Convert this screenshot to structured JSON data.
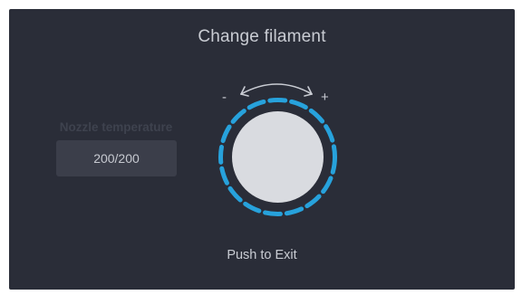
{
  "screen": {
    "title": "Change filament",
    "nozzle": {
      "label": "Nozzle temperature",
      "value": "200/200"
    },
    "knob": {
      "minus_label": "-",
      "plus_label": "+",
      "ring_color": "#27a2dc"
    },
    "hint": "Push to Exit"
  },
  "colors": {
    "background": "#2a2d38",
    "text": "#c9ccd3",
    "value_box": "#3b3e4a",
    "knob_face": "#d9dbe0",
    "accent": "#27a2dc"
  }
}
